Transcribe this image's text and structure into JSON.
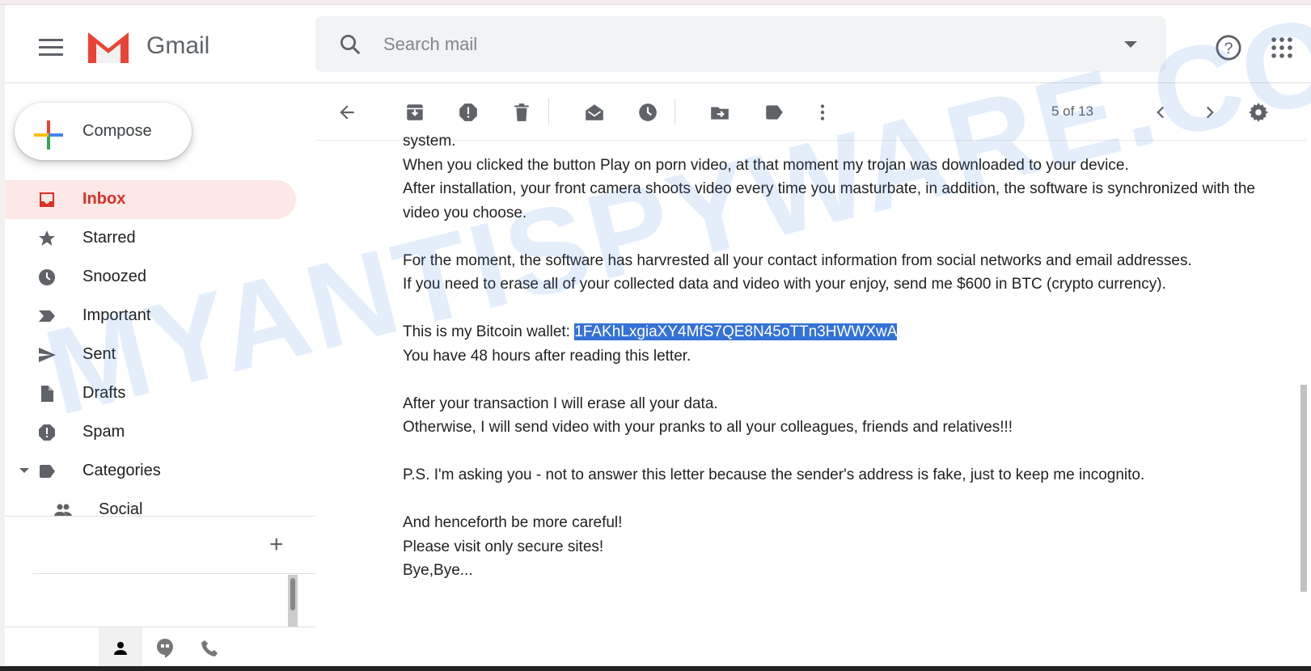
{
  "header": {
    "app_name": "Gmail",
    "search_placeholder": "Search mail"
  },
  "sidebar": {
    "compose_label": "Compose",
    "items": [
      {
        "label": "Inbox",
        "icon": "inbox-icon",
        "active": true
      },
      {
        "label": "Starred",
        "icon": "star-icon"
      },
      {
        "label": "Snoozed",
        "icon": "clock-icon"
      },
      {
        "label": "Important",
        "icon": "important-icon"
      },
      {
        "label": "Sent",
        "icon": "send-icon"
      },
      {
        "label": "Drafts",
        "icon": "draft-icon"
      },
      {
        "label": "Spam",
        "icon": "spam-icon"
      },
      {
        "label": "Categories",
        "icon": "label-icon"
      },
      {
        "label": "Social",
        "icon": "people-icon"
      }
    ]
  },
  "toolbar": {
    "count": "5 of 13"
  },
  "email": {
    "lines": [
      "system.",
      "When you clicked the button Play on porn video, at that moment my trojan was downloaded to your device.",
      "After installation, your front camera shoots video every time you masturbate, in addition, the software is synchronized with the video you choose.",
      "",
      "For the moment, the software has harvrested all your contact information from social networks and email addresses.",
      "If you need to erase all of your collected data and video with your enjoy, send me $600 in BTC (crypto currency).",
      ""
    ],
    "wallet_prefix": "This is my Bitcoin wallet: ",
    "wallet": "1FAKhLxgiaXY4MfS7QE8N45oTTn3HWWXwA",
    "lines2": [
      "You have 48 hours after reading this letter.",
      "",
      "After your transaction I will erase all your data.",
      "Otherwise, I will send video with your pranks to all your colleagues, friends and relatives!!!",
      "",
      "P.S. I'm asking you - not to answer this letter because the sender's address is fake, just to keep me incognito.",
      "",
      "And henceforth be more careful!",
      "Please visit only secure sites!",
      "Bye,Bye..."
    ]
  },
  "watermark": "MYANTISPYWARE.COM",
  "colors": {
    "accent": "#d93025",
    "active_bg": "#fce8e6",
    "selection": "#3572d6"
  }
}
